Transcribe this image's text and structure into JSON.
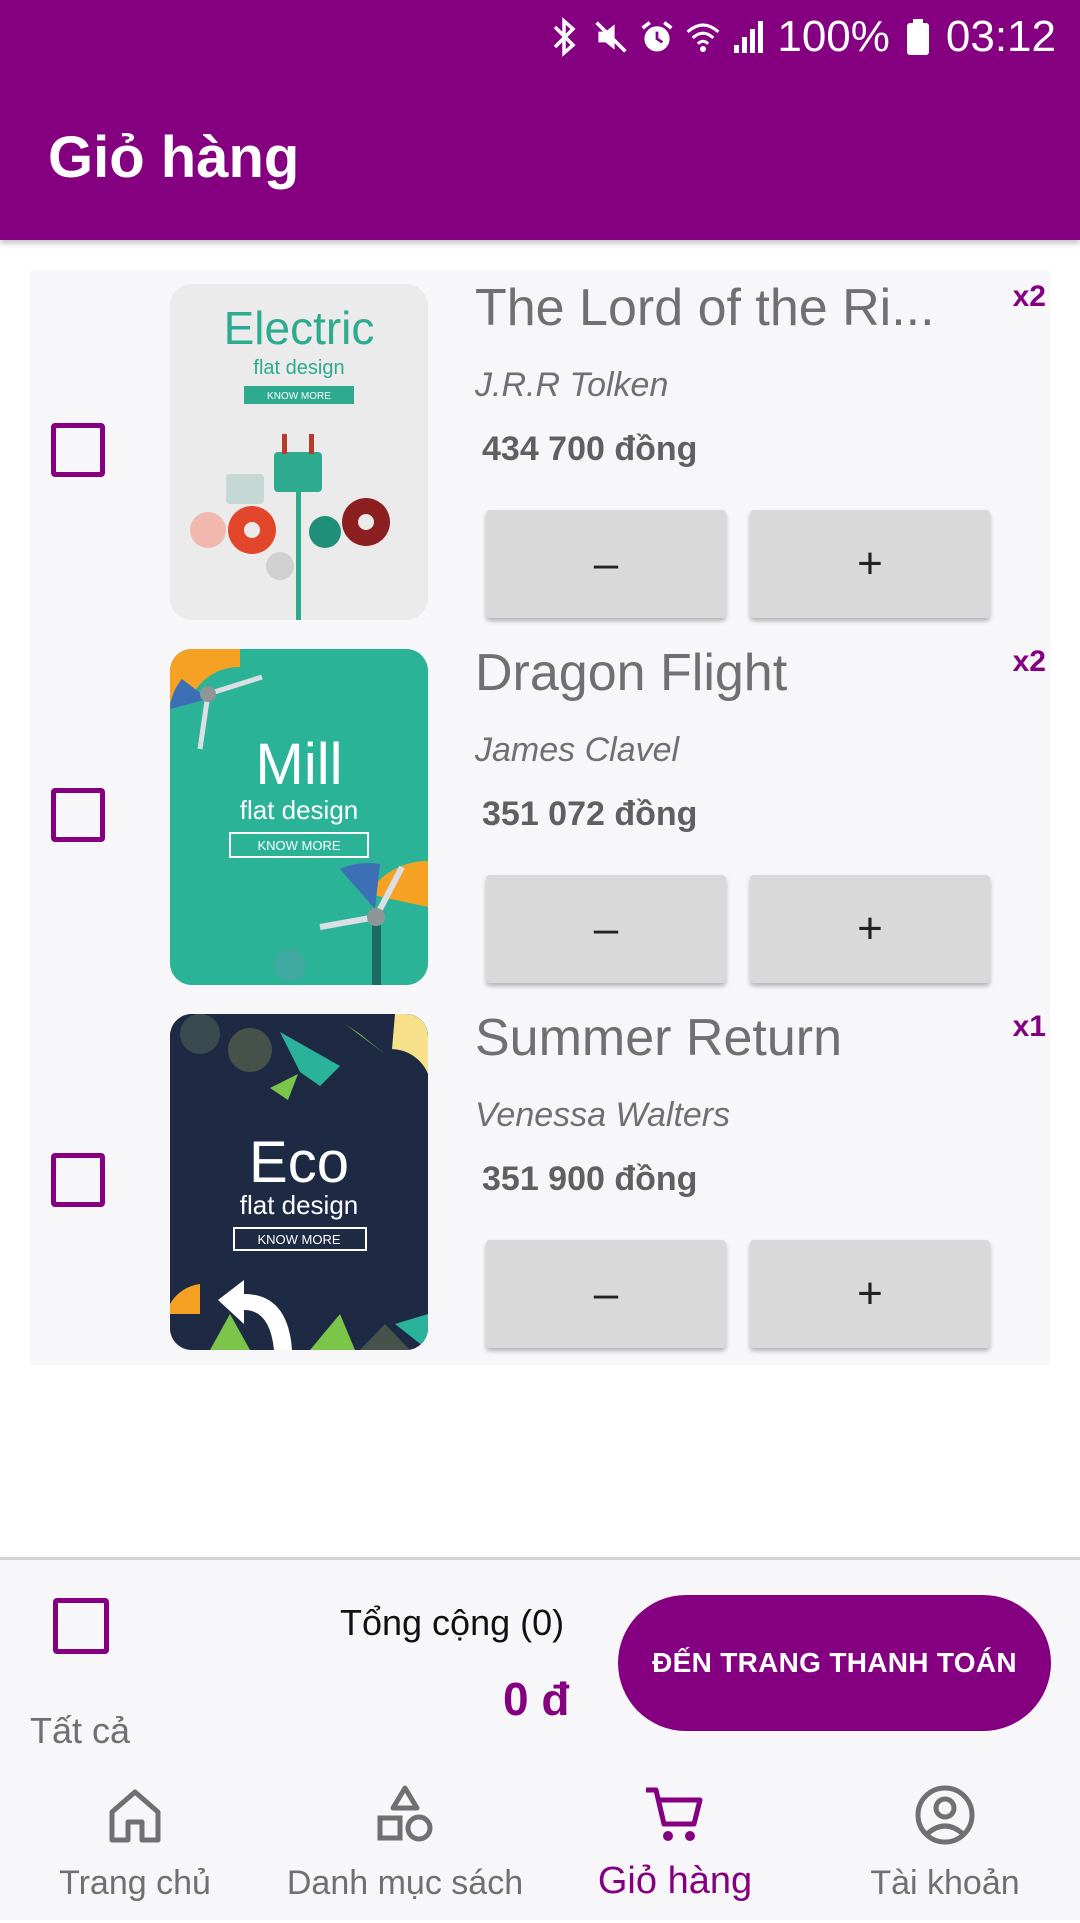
{
  "status_bar": {
    "battery": "100%",
    "time": "03:12",
    "icons": [
      "bluetooth-icon",
      "mute-icon",
      "alarm-icon",
      "wifi-icon",
      "signal-icon",
      "battery-icon"
    ]
  },
  "header": {
    "title": "Giỏ hàng"
  },
  "cart": {
    "items": [
      {
        "title": "The Lord of the Ri...",
        "author": "J.R.R Tolken",
        "price": "434 700 đồng",
        "quantity": "x2",
        "minus_label": "–",
        "plus_label": "+",
        "cover": {
          "big": "Electric",
          "sub": "flat design",
          "cta": "KNOW MORE"
        }
      },
      {
        "title": "Dragon Flight",
        "author": "James Clavel",
        "price": "351 072 đồng",
        "quantity": "x2",
        "minus_label": "–",
        "plus_label": "+",
        "cover": {
          "big": "Mill",
          "sub": "flat design",
          "cta": "KNOW MORE"
        }
      },
      {
        "title": "Summer Return",
        "author": "Venessa Walters",
        "price": "351 900 đồng",
        "quantity": "x1",
        "minus_label": "–",
        "plus_label": "+",
        "cover": {
          "big": "Eco",
          "sub": "flat design",
          "cta": "KNOW MORE"
        }
      }
    ]
  },
  "summary": {
    "select_all_label": "Tất cả",
    "total_label": "Tổng cộng (0)",
    "total_value": "0 đ",
    "checkout_label": "ĐẾN TRANG THANH TOÁN"
  },
  "nav": {
    "items": [
      {
        "label": "Trang chủ",
        "icon": "home-icon"
      },
      {
        "label": "Danh mục sách",
        "icon": "category-icon"
      },
      {
        "label": "Giỏ hàng",
        "icon": "cart-icon",
        "active": true
      },
      {
        "label": "Tài khoản",
        "icon": "account-icon"
      }
    ]
  },
  "colors": {
    "primary": "#840080",
    "surface": "#f7f7fa",
    "button": "#d9d9d9",
    "muted_text": "#707070"
  }
}
